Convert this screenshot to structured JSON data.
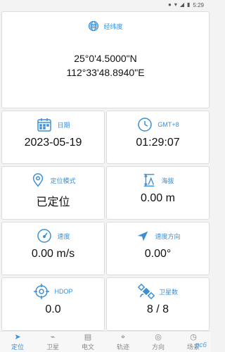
{
  "status": {
    "time": "5:29"
  },
  "coords": {
    "title": "经纬度",
    "lat": "25°0'4.5000\"N",
    "lon": "112°33'48.8940\"E"
  },
  "tiles": {
    "date": {
      "label": "日期",
      "value": "2023-05-19"
    },
    "gmt": {
      "label": "GMT+8",
      "value": "01:29:07"
    },
    "mode": {
      "label": "定位模式",
      "value": "已定位"
    },
    "altitude": {
      "label": "海拔",
      "value": "0.00 m"
    },
    "speed": {
      "label": "速度",
      "value": "0.00 m/s"
    },
    "heading": {
      "label": "速度方向",
      "value": "0.00°"
    },
    "hdop": {
      "label": "HDOP",
      "value": "0.0"
    },
    "satellites": {
      "label": "卫星数",
      "value": "8 / 8"
    }
  },
  "nav": {
    "items": [
      {
        "label": "定位",
        "icon": "location-arrow-icon"
      },
      {
        "label": "卫星",
        "icon": "satellite-icon"
      },
      {
        "label": "电文",
        "icon": "document-icon"
      },
      {
        "label": "轨迹",
        "icon": "track-icon"
      },
      {
        "label": "方向",
        "icon": "compass-icon"
      },
      {
        "label": "场景",
        "icon": "scene-icon"
      }
    ]
  },
  "watermark": "pc6",
  "colors": {
    "accent": "#3a8fd8",
    "background": "#f3f3f3",
    "card": "#ffffff"
  }
}
